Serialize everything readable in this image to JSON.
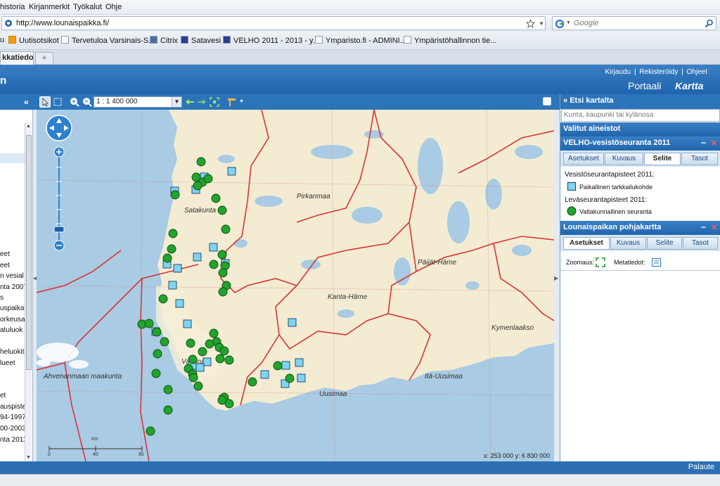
{
  "browser": {
    "menu": [
      "historia",
      "Kirjanmerkit",
      "Työkalut",
      "Ohje"
    ],
    "url": "http://www.lounaispaikka.fi/",
    "search_placeholder": "Google",
    "bookmarks": [
      "u",
      "Uutisotsikot",
      "Tervetuloa Varsinais-S...",
      "Citrix",
      "Satavesi",
      "VELHO 2011 - 2013 - y...",
      "Ymparisto.fi - ADMINI...",
      "Ympäristöhallinnon tie..."
    ],
    "tab_title": "kkatiedo...",
    "new_tab_symbol": "+"
  },
  "portal": {
    "header_links": [
      "Kirjaudu",
      "|",
      "Rekisteröidy",
      "|",
      "Ohjeet"
    ],
    "portaali": "Portaali",
    "kartta": "Kartta",
    "header_letter": "n",
    "collapse_left": "«"
  },
  "toolbar": {
    "scale": "1 : 1 400 000",
    "scale_arrow": "▼"
  },
  "left_panel": {
    "items": [
      "eet",
      "eet",
      "n vesial",
      "nta 2007",
      "s",
      "uspaikat",
      "orkeusai",
      "atuluok",
      "heluokitu",
      "lueet",
      "et",
      "auspistee",
      "94-1997",
      "00-2003",
      "nta 2011"
    ]
  },
  "map": {
    "labels": [
      "Pirkanmaa",
      "Satakunta",
      "Päijät-Häme",
      "Kanta-Häme",
      "Kymenlaakso",
      "Ahvenanmaan maakunta",
      "Varsinais",
      "Itä-Uusimaa",
      "Uusimaa"
    ],
    "scalebar_unit": "KM",
    "scalebar_ticks": [
      "0",
      "40",
      "80"
    ],
    "coordinates": "x: 253 000   y: 6 830 000"
  },
  "right_panel": {
    "search_title": "Etsi kartalta",
    "search_arrow": "»",
    "search_placeholder": "Kunta, kaupunki tai kylänosa",
    "selected_title": "Valitut aineistot",
    "layer1": {
      "title": "VELHO-vesistöseuranta 2011",
      "tabs": [
        "Asetukset",
        "Kuvaus",
        "Selite",
        "Tasot"
      ],
      "active_tab": "Selite",
      "legend_heading1": "Vesistöseurantapisteet 2011:",
      "legend_item1": "Paikallinen tarkkailukohde",
      "legend_heading2": "Leväseurantapisteet 2011:",
      "legend_item2": "Valtakunnallinen seuranta"
    },
    "layer2": {
      "title": "Lounaispaikan pohjakartta",
      "tabs": [
        "Asetukset",
        "Kuvaus",
        "Selite",
        "Tasot"
      ],
      "active_tab": "Asetukset",
      "zoom_label": "Zoomaus:",
      "metadata_label": "Metatiedot:"
    },
    "minimize_symbol": "−",
    "close_symbol": "✕"
  },
  "footer": {
    "palaute": "Palaute"
  },
  "colors": {
    "portal_blue": "#2166ad",
    "square_marker": "#7fd4ef",
    "circle_marker": "#22a32c",
    "border_red": "#d9343a",
    "water": "#a9cbe3",
    "land": "#f3ecd2"
  }
}
